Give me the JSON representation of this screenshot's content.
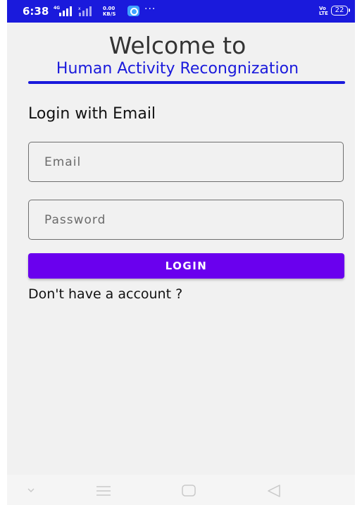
{
  "status_bar": {
    "time": "6:38",
    "net_label": "4G",
    "speed_value": "0.00",
    "speed_unit": "KB/S",
    "more": "···",
    "volte_top": "Vo",
    "volte_bottom": "LTE",
    "battery": "22",
    "colors": {
      "background": "#1a1adc",
      "foreground": "#ffffff"
    }
  },
  "header": {
    "welcome": "Welcome to",
    "subtitle": "Human Activity Recongnization",
    "accent_color": "#1a1adc"
  },
  "login": {
    "heading": "Login with Email",
    "email_placeholder": "Email",
    "password_placeholder": "Password",
    "button_label": "LOGIN",
    "button_color": "#6a00ee",
    "signup_text": "Don't have a account ?"
  },
  "nav_bar": {
    "icons": [
      "chevron-down-icon",
      "menu-icon",
      "home-icon",
      "back-icon"
    ]
  }
}
